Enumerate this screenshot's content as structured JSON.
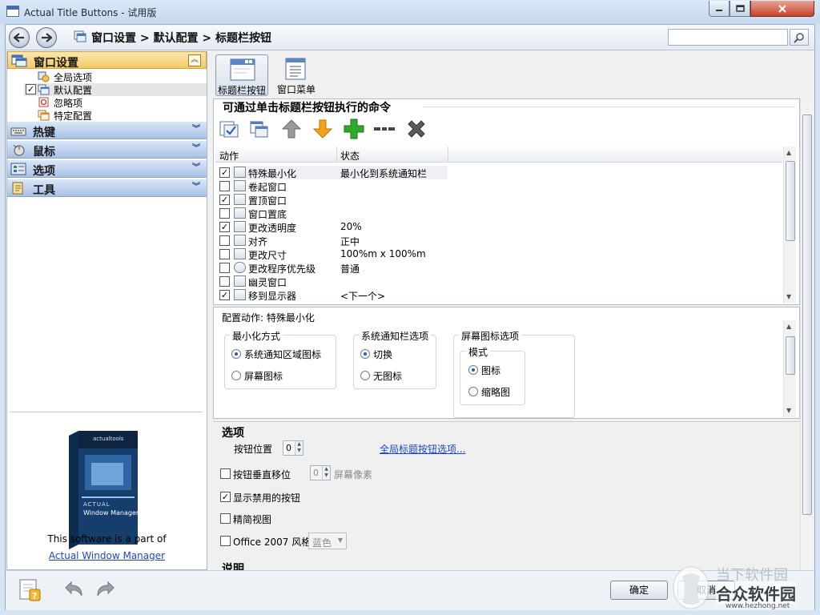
{
  "window": {
    "title": "Actual Title Buttons - 试用版"
  },
  "nav": {
    "breadcrumb": "窗口设置 > 默认配置 > 标题栏按钮",
    "search_placeholder": ""
  },
  "sidebar": {
    "sections": [
      {
        "label": "窗口设置",
        "icon": "window-settings-icon",
        "expanded": true
      },
      {
        "label": "热键",
        "icon": "keyboard-icon",
        "expanded": false
      },
      {
        "label": "鼠标",
        "icon": "mouse-icon",
        "expanded": false
      },
      {
        "label": "选项",
        "icon": "options-icon",
        "expanded": false
      },
      {
        "label": "工具",
        "icon": "tools-icon",
        "expanded": false
      }
    ],
    "tree": [
      {
        "label": "全局选项",
        "checked": null
      },
      {
        "label": "默认配置",
        "checked": true
      },
      {
        "label": "忽略项",
        "checked": null
      },
      {
        "label": "特定配置",
        "checked": null
      }
    ],
    "product_box": {
      "brand": "actualtools",
      "product_line1": "ACTUAL",
      "product_line2": "Window Manager"
    },
    "product_caption": "This software is a part of",
    "product_link": "Actual Window Manager"
  },
  "toolbar": {
    "tabs": [
      {
        "label": "标题栏按钮",
        "active": true
      },
      {
        "label": "窗口菜单",
        "active": false
      }
    ]
  },
  "commands": {
    "title": "可通过单击标题栏按钮执行的命令",
    "icons": [
      "check-all-icon",
      "duplicate-icon",
      "move-up-icon",
      "move-down-icon",
      "add-icon",
      "separator-icon",
      "delete-icon"
    ],
    "columns": [
      "动作",
      "状态"
    ],
    "rows": [
      {
        "checked": true,
        "name": "特殊最小化",
        "state": "最小化到系统通知栏",
        "selected": true
      },
      {
        "checked": false,
        "name": "卷起窗口",
        "state": ""
      },
      {
        "checked": true,
        "name": "置顶窗口",
        "state": ""
      },
      {
        "checked": false,
        "name": "窗口置底",
        "state": ""
      },
      {
        "checked": true,
        "name": "更改透明度",
        "state": "20%"
      },
      {
        "checked": false,
        "name": "对齐",
        "state": "正中"
      },
      {
        "checked": false,
        "name": "更改尺寸",
        "state": "100%m x 100%m"
      },
      {
        "checked": false,
        "name": "更改程序优先级",
        "state": "普通"
      },
      {
        "checked": false,
        "name": "幽灵窗口",
        "state": ""
      },
      {
        "checked": true,
        "name": "移到显示器",
        "state": "<下一个>"
      }
    ]
  },
  "config": {
    "title": "配置动作: 特殊最小化",
    "groups": {
      "minimize_mode": {
        "title": "最小化方式",
        "options": [
          "系统通知区域图标",
          "屏幕图标"
        ],
        "selected": 0
      },
      "tray_options": {
        "title": "系统通知栏选项",
        "options": [
          "切换",
          "无图标"
        ],
        "selected": 0
      },
      "screen_icon_options": {
        "title": "屏幕图标选项",
        "sub_title": "模式",
        "options": [
          "图标",
          "缩略图"
        ],
        "selected": 0
      }
    }
  },
  "options": {
    "title": "选项",
    "button_position_label": "按钮位置",
    "button_position_value": "0",
    "global_link": "全局标题按钮选项...",
    "vertical_shift_label": "按钮垂直移位",
    "vertical_shift_value": "0",
    "vertical_shift_unit": "屏幕像素",
    "show_disabled_label": "显示禁用的按钮",
    "show_disabled_checked": true,
    "compact_view_label": "精简视图",
    "compact_view_checked": false,
    "office_style_label": "Office 2007 风格",
    "office_style_checked": false,
    "office_style_value": "蓝色",
    "description_title": "说明"
  },
  "footer": {
    "ok_label": "确定",
    "cancel_label": "取消"
  },
  "watermark": {
    "line1": "当下软件园",
    "line2": "合众软件园",
    "url": "www.hezhong.net"
  },
  "colors": {
    "accent_section": "#f4c866",
    "blue_section": "#a9c1e6",
    "link": "#1b45c8",
    "add_green": "#2fa82b",
    "down_orange": "#f0a21c",
    "delete_gray": "#5a5a5a"
  }
}
